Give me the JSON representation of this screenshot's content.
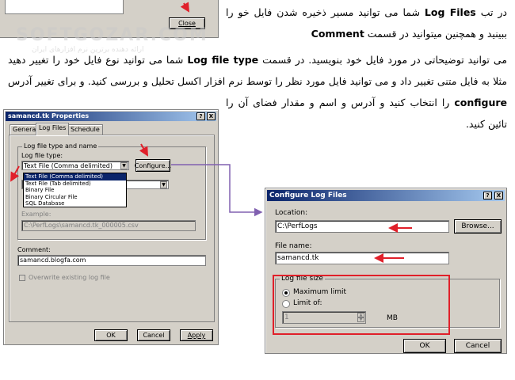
{
  "article": {
    "para1_a": "در تب",
    "para1_tab": "Log Files",
    "para1_b": "شما می توانید مسیر ذخیره شدن فایل خو را ببینید و همچنین میتوانید در قسمت",
    "para1_comment": "Comment",
    "para1_c": "می توانید توضیحاتی در مورد فایل خود بنویسید. در قسمت",
    "para1_type": "Log file type",
    "para1_d": "شما می توانید نوع فایل خود را تغییر دهید مثلا به فایل متنی تغییر داد و می توانید فایل مورد نظر را توسط نرم افزار اکسل تحلیل و بررسی کنید. و برای تغییر آدرس ذخیره سازی بر روی",
    "para1_configure": "configure",
    "para1_e": "را انتخاب کنید و آدرس و اسم و مقدار فضای آن را تائین کنید."
  },
  "watermark": {
    "main": "SOFTGOZAR.COM",
    "sub": "ارائه دهنده برترین نرم افزارهای ایران"
  },
  "top_dialog": {
    "close_label": "Close"
  },
  "properties_dialog": {
    "title": "samancd.tk Properties",
    "help_btn": "?",
    "close_btn": "X",
    "tabs": [
      "General",
      "Log Files",
      "Schedule"
    ],
    "active_tab": "Log Files",
    "group_label": "Log file type and name",
    "type_label": "Log file type:",
    "type_value": "Text File (Comma delimited)",
    "configure_label": "Configure...",
    "dropdown_options": [
      "Text File (Comma delimited)",
      "Text File (Tab delimited)",
      "Binary File",
      "Binary Circular File",
      "SQL Database"
    ],
    "example_label": "Example:",
    "example_value": "C:\\PerfLogs\\samancd.tk_000005.csv",
    "comment_label": "Comment:",
    "comment_value": "samancd.blogfa.com",
    "overwrite_label": "Overwrite existing log file",
    "ok_label": "OK",
    "cancel_label": "Cancel",
    "apply_label": "Apply"
  },
  "configure_dialog": {
    "title": "Configure Log Files",
    "help_btn": "?",
    "close_btn": "X",
    "location_label": "Location:",
    "location_value": "C:\\PerfLogs",
    "browse_label": "Browse...",
    "filename_label": "File name:",
    "filename_value": "samancd.tk",
    "size_group_label": "Log file size",
    "max_limit_label": "Maximum limit",
    "limit_of_label": "Limit of:",
    "limit_value": "1",
    "unit_label": "MB",
    "ok_label": "OK",
    "cancel_label": "Cancel"
  },
  "colors": {
    "annotation_red": "#e0202a",
    "annotation_purple": "#8060b0",
    "titlebar_blue": "#0a246a"
  }
}
